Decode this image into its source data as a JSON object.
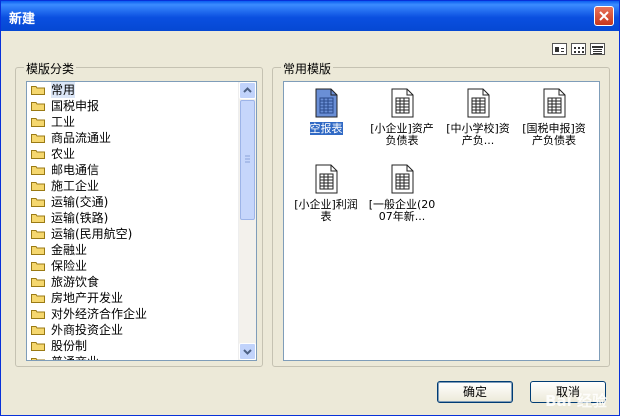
{
  "window": {
    "title": "新建"
  },
  "view_icons": [
    "large-icons-view-icon",
    "small-icons-view-icon",
    "list-view-icon"
  ],
  "category_group": {
    "label": "模版分类",
    "items": [
      "常用",
      "国税申报",
      "工业",
      "商品流通业",
      "农业",
      "邮电通信",
      "施工企业",
      "运输(交通)",
      "运输(铁路)",
      "运输(民用航空)",
      "金融业",
      "保险业",
      "旅游饮食",
      "房地产开发业",
      "对外经济合作企业",
      "外商投资企业",
      "股份制",
      "普通商业"
    ],
    "selected_index": 0
  },
  "template_group": {
    "label": "常用模版",
    "tiles": [
      {
        "label": "空报表",
        "selected": true
      },
      {
        "label": "[小企业]资产负债表",
        "selected": false
      },
      {
        "label": "[中小学校]资产负...",
        "selected": false
      },
      {
        "label": "[国税申报]资产负债表",
        "selected": false
      },
      {
        "label": "[小企业]利润表",
        "selected": false
      },
      {
        "label": "[一般企业(2007年新...",
        "selected": false
      }
    ]
  },
  "buttons": {
    "ok": "确定",
    "cancel": "取消"
  },
  "watermark": "Bai 经验",
  "colors": {
    "titlebar": "#0a4fe0",
    "selection": "#316ac5",
    "folder": "#f5d76e"
  }
}
